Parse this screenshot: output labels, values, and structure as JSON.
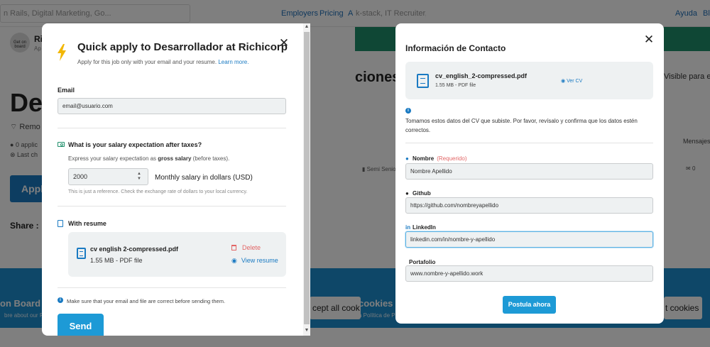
{
  "background": {
    "search_text": "n Rails, Digital Marketing, Go...",
    "nav": [
      "Employers",
      "Pricing",
      "AT"
    ],
    "search2_text": "k-stack, IT Recruiter, API...",
    "nav_right": [
      "Ayuda",
      "Blo"
    ],
    "company_name": "Ri",
    "company_logo_text": "Get on board",
    "company_sub": "Ap",
    "big_title": "De",
    "remote_text": "Remo",
    "meta1": "0 applic",
    "meta2": "Last ch",
    "apply_button": "Appl",
    "share_label": "Share :",
    "ciones_text": "ciones",
    "visible_text": "Visible para emp",
    "mensajes": "Mensajes",
    "semi_senior": "Semi Senior",
    "chat_count": "0",
    "cookie_left_title": "on Board u",
    "cookie_left_sub": "bre about our P",
    "cookie_right_title": "cookies",
    "cookie_right_sub": "a Política de P",
    "accept1": "cept all cook",
    "accept2": "t cookies"
  },
  "quick_apply": {
    "title": "Quick apply to Desarrollador at Richicorp",
    "subtitle": "Apply for this job only with your email and your resume.",
    "learn_more": "Learn more.",
    "email_label": "Email",
    "email_value": "email@usuario.com",
    "salary_label": "What is your salary expectation after taxes?",
    "salary_help_prefix": "Express your salary expectation as",
    "salary_help_bold": "gross salary",
    "salary_help_suffix": "(before taxes).",
    "salary_value": "2000",
    "salary_unit": "Monthly salary in dollars (USD)",
    "salary_reference": "This is just a reference. Check the exchange rate of dollars to your local currency.",
    "resume_label": "With resume",
    "file_name": "cv english 2-compressed.pdf",
    "file_size": "1.55 MB - PDF file",
    "delete_label": "Delete",
    "view_label": "View resume",
    "note": "Make sure that your email and file are correct before sending them.",
    "send_label": "Send"
  },
  "contact_info": {
    "title": "Información de Contacto",
    "cv_name": "cv_english_2-compressed.pdf",
    "cv_size": "1.55 MB - PDF file",
    "view_cv": "Ver CV",
    "info_text": "Tomamos estos datos del CV que subiste. Por favor, revísalo y confirma que los datos estén correctos.",
    "name_label": "Nombre",
    "required": "(Requerido)",
    "name_value": "Nombre Apellido",
    "github_label": "Github",
    "github_value": "https://github.com/nombreyapellido",
    "linkedin_label": "LinkedIn",
    "linkedin_value": "linkedin.com/in/nombre-y-apellido",
    "portfolio_label": "Portafolio",
    "portfolio_value": "www.nombre-y-apellido.work",
    "submit_label": "Postula ahora"
  },
  "colors": {
    "accent": "#1d9ad6",
    "link": "#1a7ac2",
    "danger": "#e26666",
    "cookie_bar": "#1d8fd0",
    "green_bar": "#1f8f6b"
  }
}
